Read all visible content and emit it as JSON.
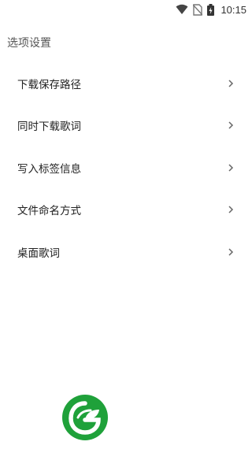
{
  "status_bar": {
    "time": "10:15",
    "icons": [
      "wifi-icon",
      "no-sim-icon",
      "battery-charging-icon"
    ]
  },
  "page": {
    "title": "选项设置"
  },
  "menu": {
    "items": [
      {
        "label": "下载保存路径",
        "icon": "chevron-right-icon"
      },
      {
        "label": "同时下载歌词",
        "icon": "chevron-right-icon"
      },
      {
        "label": "写入标签信息",
        "icon": "chevron-right-icon"
      },
      {
        "label": "文件命名方式",
        "icon": "chevron-right-icon"
      },
      {
        "label": "桌面歌词",
        "icon": "chevron-right-icon"
      }
    ]
  },
  "colors": {
    "background": "#ffffff",
    "text": "#222222",
    "title": "#555555",
    "chevron": "#666666",
    "logo_green": "#1fa13a"
  },
  "logo": {
    "icon": "app-logo-leaf-icon"
  }
}
